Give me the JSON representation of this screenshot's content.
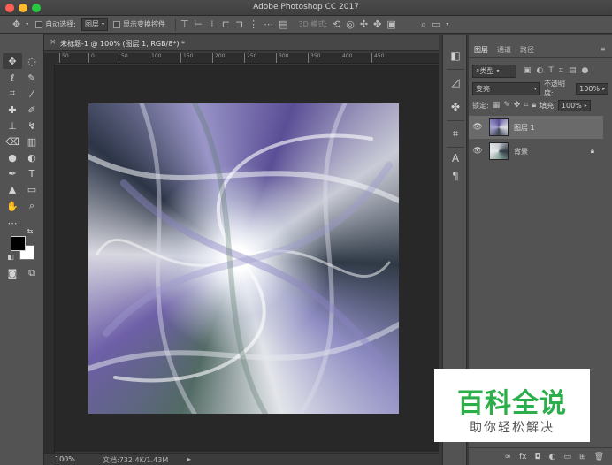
{
  "app": {
    "title": "Adobe Photoshop CC 2017"
  },
  "options_bar": {
    "auto_select_label": "自动选择:",
    "auto_select_value": "图层",
    "show_transform_label": "显示变换控件",
    "mode_3d_label": "3D 模式:"
  },
  "document": {
    "tab_title": "未标题-1 @ 100% (图层 1, RGB/8*) *",
    "zoom": "100%",
    "doc_info": "文档:732.4K/1.43M",
    "ruler_ticks": [
      "50",
      "0",
      "50",
      "100",
      "150",
      "200",
      "250",
      "300",
      "350",
      "400",
      "450"
    ]
  },
  "layers_panel": {
    "tabs": [
      "图层",
      "通道",
      "路径"
    ],
    "filter_label": "类型",
    "blend_mode": "变亮",
    "opacity_label": "不透明度:",
    "opacity_value": "100%",
    "lock_label": "锁定:",
    "fill_label": "填充:",
    "fill_value": "100%",
    "layers": [
      {
        "name": "图层 1",
        "selected": true
      },
      {
        "name": "背景",
        "locked": true
      }
    ]
  },
  "watermark": {
    "title": "百科全说",
    "subtitle": "助你轻松解决"
  },
  "colors": {
    "foreground": "#000000",
    "background": "#ffffff",
    "watermark_green": "#2cae4a"
  }
}
